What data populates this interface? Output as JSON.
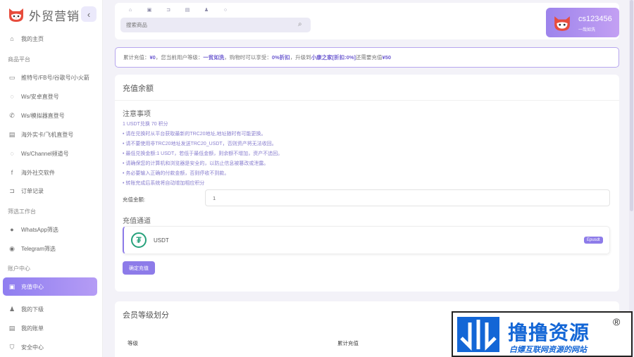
{
  "brand": {
    "title": "外贸营销",
    "collapse_glyph": "‹"
  },
  "sidebar": {
    "items": [
      {
        "label": "我的主页",
        "icon": "home-icon"
      },
      {
        "section": "商品平台"
      },
      {
        "label": "推特号/FB号/谷歌号/小火箭",
        "icon": "message-icon"
      },
      {
        "label": "Ws/安卓直登号",
        "icon": "whatsapp-icon"
      },
      {
        "label": "Ws/模拟器直登号",
        "icon": "phone-icon"
      },
      {
        "label": "海外实卡/飞机直登号",
        "icon": "document-icon"
      },
      {
        "label": "Ws/Channel频道号",
        "icon": "whatsapp-icon"
      },
      {
        "label": "海外社交软件",
        "icon": "facebook-icon"
      },
      {
        "label": "订单记录",
        "icon": "cart-icon"
      },
      {
        "section": "筛选工作台"
      },
      {
        "label": "WhatsApp筛选",
        "icon": "whatsapp-icon"
      },
      {
        "label": "Telegram筛选",
        "icon": "telegram-icon"
      },
      {
        "section": "账户中心"
      },
      {
        "label": "充值中心",
        "icon": "wallet-icon",
        "active": true
      },
      {
        "label": "我的下级",
        "icon": "users-icon"
      },
      {
        "label": "我的账单",
        "icon": "bill-icon"
      },
      {
        "label": "安全中心",
        "icon": "shield-icon"
      }
    ]
  },
  "header": {
    "search_placeholder": "搜索商品",
    "icons": [
      "home-icon",
      "store-icon",
      "cart-icon",
      "document-icon",
      "user-icon",
      "settings-icon"
    ]
  },
  "user": {
    "name": "cs123456",
    "level": "一哉如洗"
  },
  "notice": {
    "prefix": "累计充值：",
    "total": "¥0",
    "level_text": "，您当前用户等级：",
    "level": "一贫如洗",
    "discount_text": "，购物时可以享受：",
    "discount": "0%折扣",
    "upgrade_text": "，升级到 ",
    "next_level": "小康之家[折扣:0%]",
    "need_text": " 还需要充值 ",
    "need": "¥50"
  },
  "recharge": {
    "title": "充值余额",
    "notes_title": "注意事项",
    "notes": [
      "1 USDT兑换 70 积分",
      "• 请在兑换时从平台获取最新的TRC20地址,地址随时有可能更换。",
      "• 请不要使用非TRC20地址发送TRC20_USDT，否则资产将无法收回。",
      "• 最低兑换金额:1 USDT，若低于最低金额，则余额不增加，资产不追回。",
      "• 请确保您的计算机和浏览器是安全的，以防止信息被篡改或泄露。",
      "• 务必要输入正确的付款金额，否则停收不到款。",
      "• 转账完成后系统将自动增加相应积分"
    ],
    "amount_label": "充值金额:",
    "amount_value": "1",
    "channel_title": "充值通道",
    "channel_name": "USDT",
    "channel_badge": "Epusdt",
    "confirm_label": "确定充值"
  },
  "levels": {
    "title": "会员等级划分",
    "columns": [
      "等级",
      "累计充值"
    ]
  },
  "watermark": {
    "big": "撸撸资源",
    "small": "白嫖互联网资源的网站",
    "reg": "®"
  },
  "colors": {
    "accent": "#8d7be9",
    "accent_light": "#b59cf5",
    "watermark_blue": "#1366d6"
  }
}
